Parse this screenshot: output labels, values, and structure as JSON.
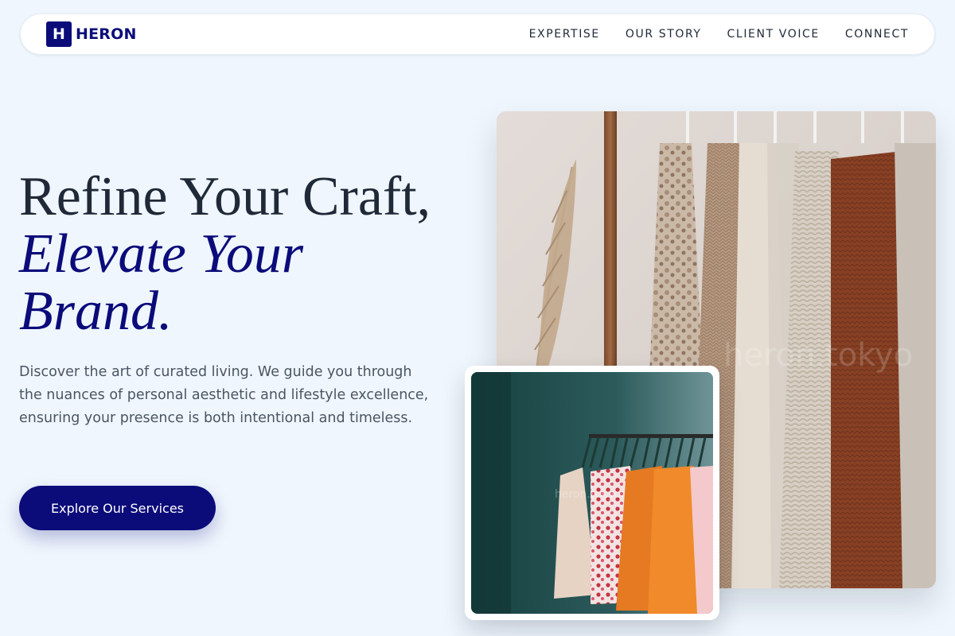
{
  "brand": {
    "logo_letter": "H",
    "name": "HERON"
  },
  "nav": {
    "links": [
      "EXPERTISE",
      "OUR STORY",
      "CLIENT VOICE",
      "CONNECT"
    ]
  },
  "hero": {
    "title_line1": "Refine Your Craft,",
    "title_line2": "Elevate Your",
    "title_line3": "Brand.",
    "description": "Discover the art of curated living. We guide you through the nuances of personal aesthetic and lifestyle excellence, ensuring your presence is both intentional and timeless.",
    "cta_label": "Explore Our Services"
  },
  "images": {
    "main_watermark": "heron.tokyo",
    "small_watermark": "heron.tokyo"
  },
  "colors": {
    "accent": "#0b0b7a",
    "background": "#eff6fd",
    "text": "#1f2937",
    "muted": "#4b5563"
  }
}
